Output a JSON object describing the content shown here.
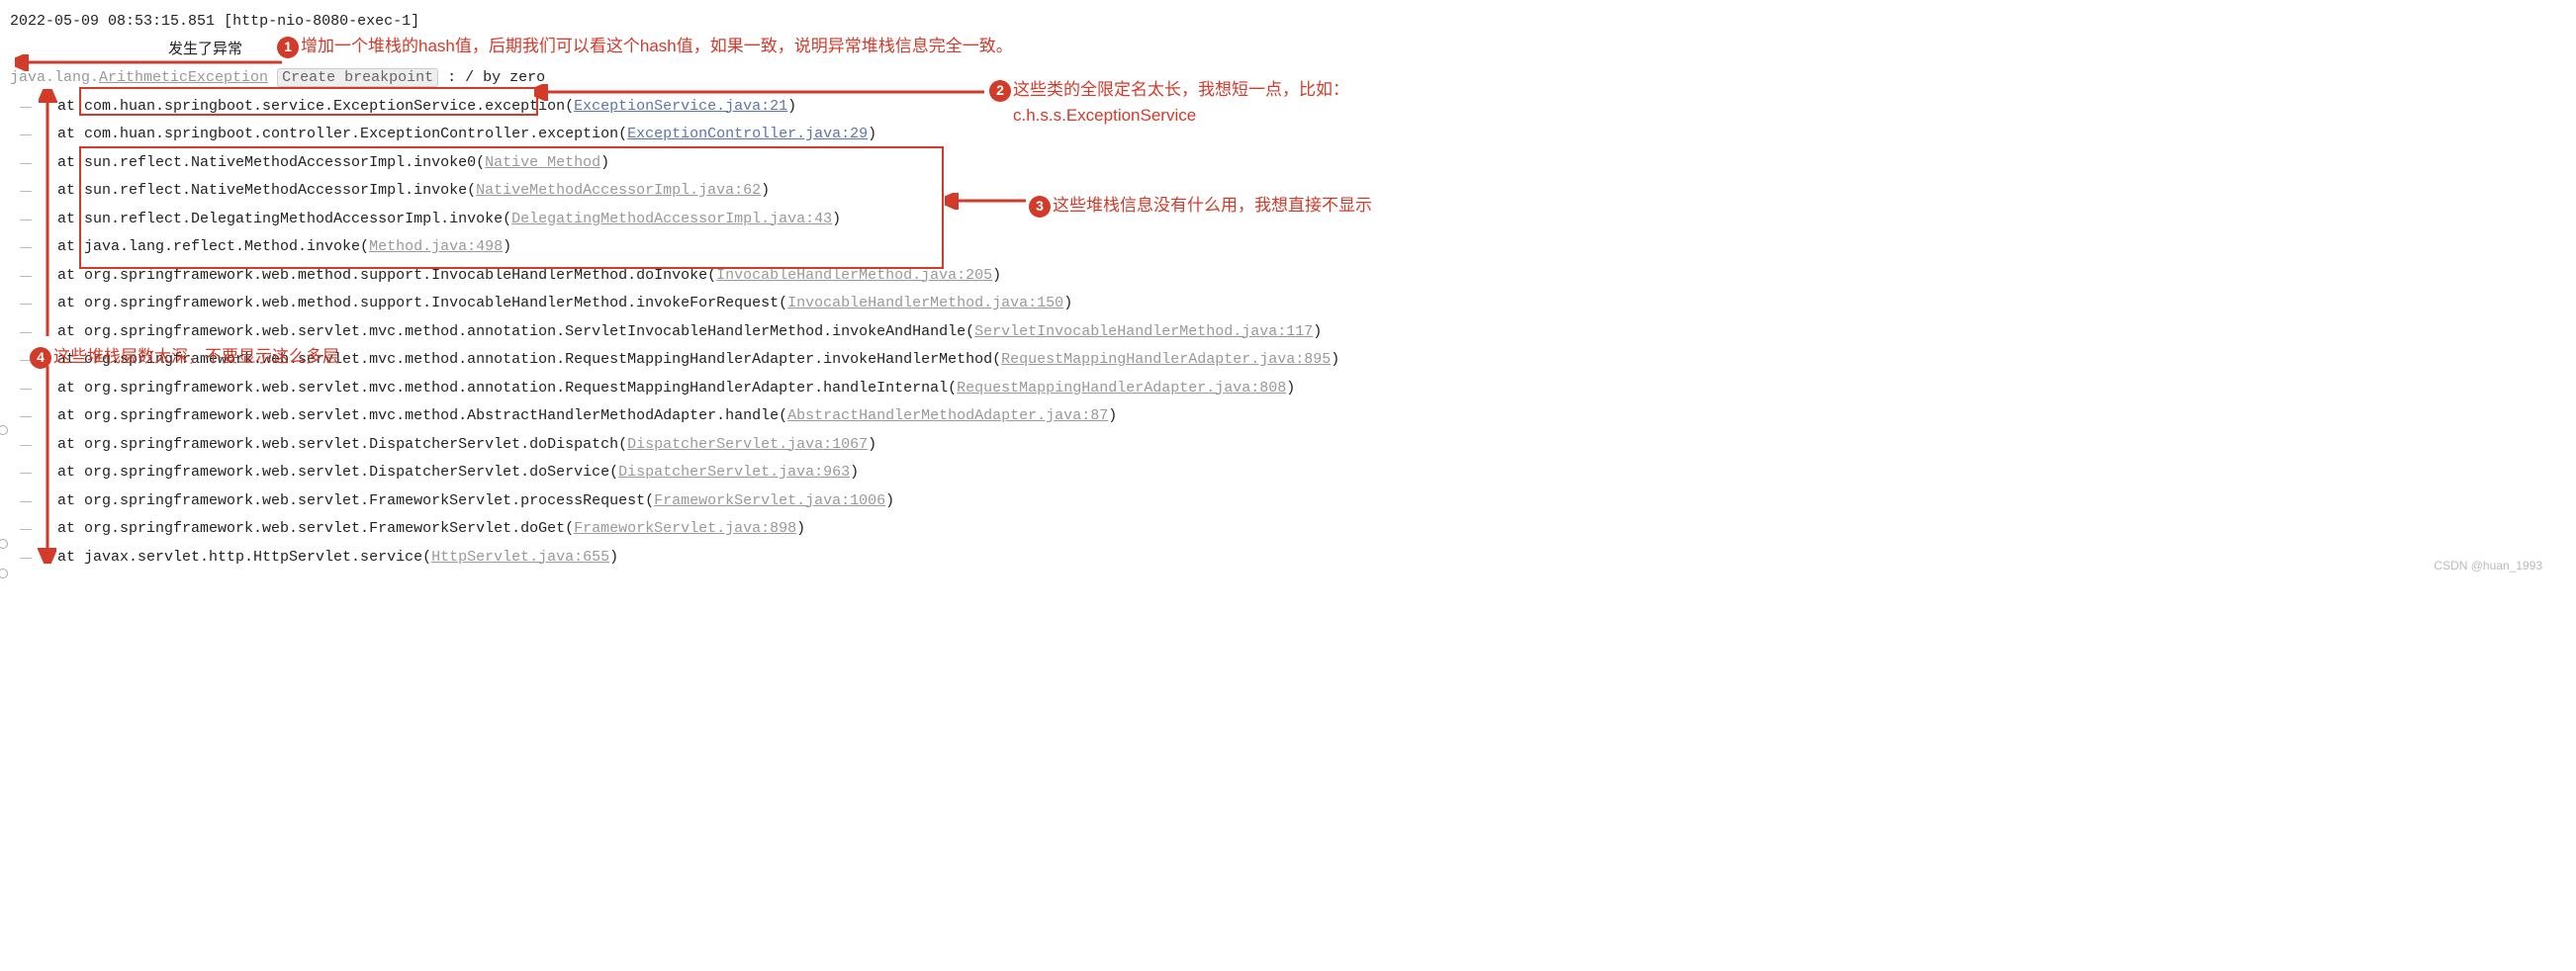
{
  "timestamp": "2022-05-09 08:53:15.851",
  "thread": "[http-nio-8080-exec-1]",
  "cn_header": "发生了异常",
  "exception_root_prefix": "java.lang.",
  "exception_root": "ArithmeticException",
  "create_breakpoint": "Create breakpoint",
  "root_message": " : / by zero",
  "trace": [
    {
      "at": "at ",
      "pkg": "com.huan.springboot.service.ExceptionService",
      "method": ".exception(",
      "link": "ExceptionService.java:21",
      "tail": ")",
      "linkCls": "link"
    },
    {
      "at": "at ",
      "pkg": "com.huan.springboot.controller.ExceptionController.exception(",
      "method": "",
      "link": "ExceptionController.java:29",
      "tail": ")",
      "linkCls": "link"
    },
    {
      "at": "at ",
      "pkg": "sun.reflect.NativeMethodAccessorImpl.invoke0(",
      "method": "",
      "link": "Native Method",
      "tail": ")",
      "linkCls": "dim-link"
    },
    {
      "at": "at ",
      "pkg": "sun.reflect.NativeMethodAccessorImpl.invoke(",
      "method": "",
      "link": "NativeMethodAccessorImpl.java:62",
      "tail": ")",
      "linkCls": "dim-link"
    },
    {
      "at": "at ",
      "pkg": "sun.reflect.DelegatingMethodAccessorImpl.invoke(",
      "method": "",
      "link": "DelegatingMethodAccessorImpl.java:43",
      "tail": ")",
      "linkCls": "dim-link"
    },
    {
      "at": "at ",
      "pkg": "java.lang.reflect.Method.invoke(",
      "method": "",
      "link": "Method.java:498",
      "tail": ")",
      "linkCls": "dim-link"
    },
    {
      "at": "at ",
      "pkg": "org.springframework.web.method.support.InvocableHandlerMethod.doInvoke(",
      "method": "",
      "link": "InvocableHandlerMethod.java:205",
      "tail": ")",
      "linkCls": "dim-link"
    },
    {
      "at": "at ",
      "pkg": "org.springframework.web.method.support.InvocableHandlerMethod.invokeForRequest(",
      "method": "",
      "link": "InvocableHandlerMethod.java:150",
      "tail": ")",
      "linkCls": "dim-link"
    },
    {
      "at": "at ",
      "pkg": "org.springframework.web.servlet.mvc.method.annotation.ServletInvocableHandlerMethod.invokeAndHandle(",
      "method": "",
      "link": "ServletInvocableHandlerMethod.java:117",
      "tail": ")",
      "linkCls": "dim-link"
    },
    {
      "at": "at ",
      "pkg": "org.springframework.web.servlet.mvc.method.annotation.RequestMappingHandlerAdapter.invokeHandlerMethod(",
      "method": "",
      "link": "RequestMappingHandlerAdapter.java:895",
      "tail": ")",
      "linkCls": "dim-link"
    },
    {
      "at": "at ",
      "pkg": "org.springframework.web.servlet.mvc.method.annotation.RequestMappingHandlerAdapter.handleInternal(",
      "method": "",
      "link": "RequestMappingHandlerAdapter.java:808",
      "tail": ")",
      "linkCls": "dim-link"
    },
    {
      "at": "at ",
      "pkg": "org.springframework.web.servlet.mvc.method.AbstractHandlerMethodAdapter.handle(",
      "method": "",
      "link": "AbstractHandlerMethodAdapter.java:87",
      "tail": ")",
      "linkCls": "dim-link"
    },
    {
      "at": "at ",
      "pkg": "org.springframework.web.servlet.DispatcherServlet.doDispatch(",
      "method": "",
      "link": "DispatcherServlet.java:1067",
      "tail": ")",
      "linkCls": "dim-link"
    },
    {
      "at": "at ",
      "pkg": "org.springframework.web.servlet.DispatcherServlet.doService(",
      "method": "",
      "link": "DispatcherServlet.java:963",
      "tail": ")",
      "linkCls": "dim-link"
    },
    {
      "at": "at ",
      "pkg": "org.springframework.web.servlet.FrameworkServlet.processRequest(",
      "method": "",
      "link": "FrameworkServlet.java:1006",
      "tail": ")",
      "linkCls": "dim-link"
    },
    {
      "at": "at ",
      "pkg": "org.springframework.web.servlet.FrameworkServlet.doGet(",
      "method": "",
      "link": "FrameworkServlet.java:898",
      "tail": ")",
      "linkCls": "dim-link"
    },
    {
      "at": "at ",
      "pkg": "javax.servlet.http.HttpServlet.service(",
      "method": "",
      "link": "HttpServlet.java:655",
      "tail": ")",
      "linkCls": "dim-link"
    }
  ],
  "annotations": {
    "a1": "增加一个堆栈的hash值，后期我们可以看这个hash值，如果一致，说明异常堆栈信息完全一致。",
    "a2_l1": "这些类的全限定名太长，我想短一点，比如：",
    "a2_l2": "c.h.s.s.ExceptionService",
    "a3": "这些堆栈信息没有什么用，我想直接不显示",
    "a4": "这些堆栈层数太深，不要显示这么多层"
  },
  "watermark": "CSDN @huan_1993"
}
